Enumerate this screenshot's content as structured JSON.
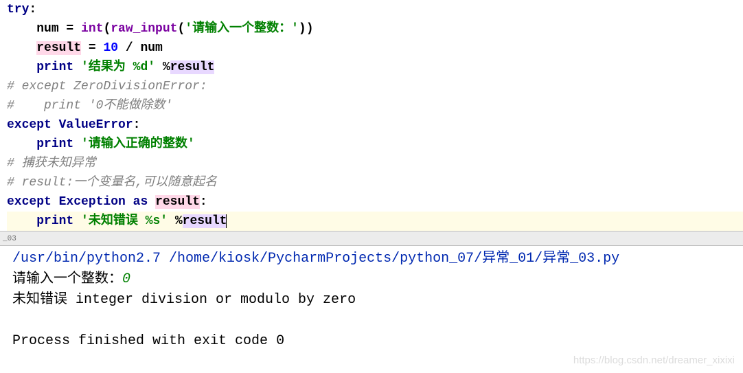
{
  "code": {
    "l1": {
      "kw": "try",
      "colon": ":"
    },
    "l2": {
      "indent": "    ",
      "var": "num",
      "eq": " = ",
      "fn1": "int",
      "p1": "(",
      "fn2": "raw_input",
      "p2": "(",
      "str": "'请输入一个整数：'",
      "p3": "))"
    },
    "l3": {
      "indent": "    ",
      "var": "result",
      "eq": " = ",
      "num": "10",
      "op": " / ",
      "var2": "num"
    },
    "l4": {
      "indent": "    ",
      "kw": "print",
      "sp": " ",
      "str": "'结果为 %d'",
      "sp2": " %",
      "var": "result"
    },
    "l5": {
      "comment": "# except ZeroDivisionError:"
    },
    "l6": {
      "comment": "#    print '0不能做除数'"
    },
    "l7": {
      "kw": "except",
      "sp": " ",
      "cls": "ValueError",
      "colon": ":"
    },
    "l8": {
      "indent": "    ",
      "kw": "print",
      "sp": " ",
      "str": "'请输入正确的整数'"
    },
    "l9": {
      "comment": "# 捕获未知异常"
    },
    "l10": {
      "comment": "# result:一个变量名,可以随意起名"
    },
    "l11": {
      "kw": "except",
      "sp": " ",
      "cls": "Exception",
      "sp2": " ",
      "kw2": "as",
      "sp3": " ",
      "var": "result",
      "colon": ":"
    },
    "l12": {
      "indent": "    ",
      "kw": "print",
      "sp": " ",
      "str": "'未知错误 %s'",
      "sp2": " %",
      "var": "result"
    }
  },
  "divider": "_03",
  "console": {
    "cmd": "/usr/bin/python2.7 /home/kiosk/PycharmProjects/python_07/异常_01/异常_03.py",
    "prompt": "请输入一个整数：",
    "input": "0",
    "out1": "未知错误 integer division or modulo by zero",
    "blank": " ",
    "exit": "Process finished with exit code 0"
  },
  "watermark": "https://blog.csdn.net/dreamer_xixixi"
}
